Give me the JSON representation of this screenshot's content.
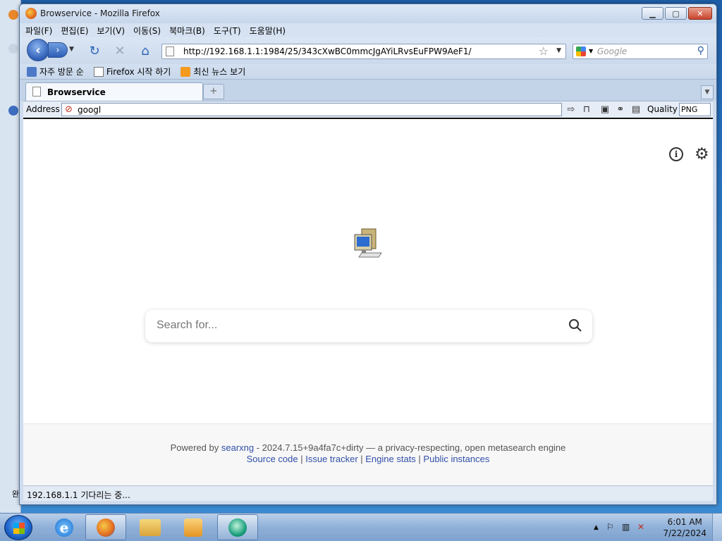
{
  "window": {
    "title": "Browservice - Mozilla Firefox"
  },
  "menu": [
    "파일(F)",
    "편집(E)",
    "보기(V)",
    "이동(S)",
    "북마크(B)",
    "도구(T)",
    "도움말(H)"
  ],
  "nav": {
    "url": "http://192.168.1.1:1984/25/343cXwBC0mmcJgAYiLRvsEuFPW9AeF1/",
    "search_placeholder": "Google"
  },
  "bookmarks": [
    "자주 방문 순",
    "Firefox 시작 하기",
    "최신 뉴스 보기"
  ],
  "tab": {
    "label": "Browservice"
  },
  "addressbar": {
    "label": "Address",
    "value": "googl",
    "quality_label": "Quality",
    "quality_value": "PNG"
  },
  "page": {
    "search_placeholder": "Search for...",
    "footer_powered": "Powered by",
    "footer_engine": "searxng",
    "footer_version": " - 2024.7.15+9a4fa7c+dirty — a privacy-respecting, open metasearch engine",
    "footer_links": [
      "Source code",
      "Issue tracker",
      "Engine stats",
      "Public instances"
    ]
  },
  "status": {
    "text": "192.168.1.1 기다리는 중..."
  },
  "taskbar": {
    "time": "6:01 AM",
    "date": "7/22/2024"
  },
  "background_window": {
    "fragment": "완"
  }
}
